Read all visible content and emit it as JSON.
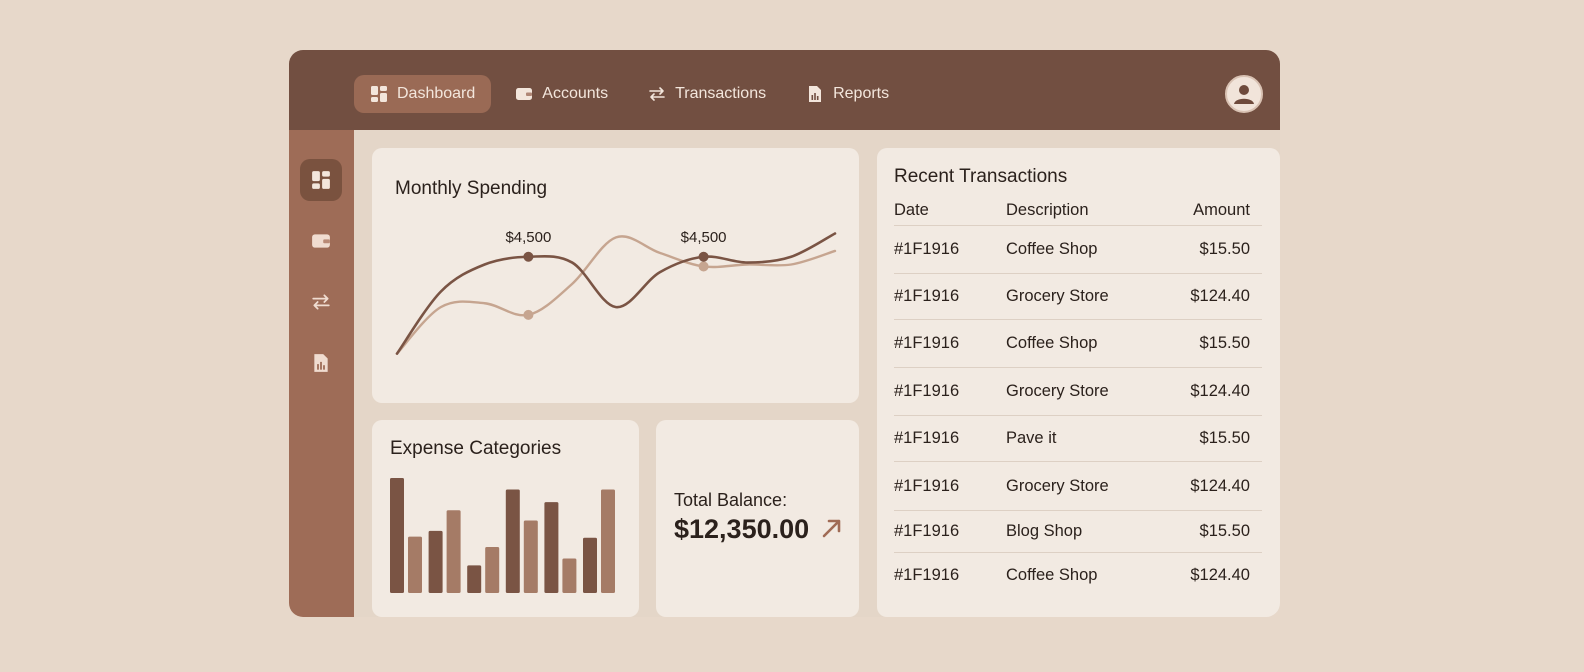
{
  "nav": {
    "items": [
      {
        "label": "Dashboard",
        "icon": "dashboard-icon",
        "active": true
      },
      {
        "label": "Accounts",
        "icon": "wallet-icon",
        "active": false
      },
      {
        "label": "Transactions",
        "icon": "transfer-icon",
        "active": false
      },
      {
        "label": "Reports",
        "icon": "report-icon",
        "active": false
      }
    ]
  },
  "sidebar": {
    "items": [
      {
        "icon": "dashboard-icon",
        "active": true
      },
      {
        "icon": "wallet-icon",
        "active": false
      },
      {
        "icon": "transfer-icon",
        "active": false
      },
      {
        "icon": "report-icon",
        "active": false
      }
    ]
  },
  "monthly_spending": {
    "title": "Monthly Spending",
    "labels": [
      "$4,500",
      "$4,500"
    ]
  },
  "expense_categories": {
    "title": "Expense Categories"
  },
  "balance": {
    "label": "Total Balance:",
    "value": "$12,350.00"
  },
  "transactions": {
    "title": "Recent Transactions",
    "headers": {
      "date": "Date",
      "description": "Description",
      "amount": "Amount"
    },
    "rows": [
      {
        "date": "#1F1916",
        "description": "Coffee Shop",
        "amount": "$15.50"
      },
      {
        "date": "#1F1916",
        "description": "Grocery Store",
        "amount": "$124.40"
      },
      {
        "date": "#1F1916",
        "description": "Coffee Shop",
        "amount": "$15.50"
      },
      {
        "date": "#1F1916",
        "description": "Grocery Store",
        "amount": "$124.40"
      },
      {
        "date": "#1F1916",
        "description": "Pave it",
        "amount": "$15.50"
      },
      {
        "date": "#1F1916",
        "description": "Grocery Store",
        "amount": "$124.40"
      },
      {
        "date": "#1F1916",
        "description": "Blog Shop",
        "amount": "$15.50"
      },
      {
        "date": "#1F1916",
        "description": "Coffee Shop",
        "amount": "$124.40"
      }
    ]
  },
  "colors": {
    "topbar": "#724f41",
    "sidebar": "#9e6c57",
    "active_pill": "#9a6a55",
    "card": "#f2eae2",
    "background": "#e7d8ca",
    "series_dark": "#7a5444",
    "series_light": "#c6a590",
    "accent_arrow": "#a06b55"
  },
  "chart_data": [
    {
      "type": "line",
      "title": "Monthly Spending",
      "x": [
        0,
        1,
        2,
        3,
        4,
        5,
        6,
        7,
        8,
        9,
        10
      ],
      "series": [
        {
          "values": [
            2000,
            3600,
            4300,
            4500,
            4350,
            3200,
            4100,
            4500,
            4350,
            4500,
            5100
          ]
        },
        {
          "values": [
            2000,
            3200,
            3300,
            3000,
            3800,
            5000,
            4600,
            4250,
            4300,
            4300,
            4650
          ]
        }
      ],
      "annotations": [
        {
          "x": 3,
          "series": 0,
          "label": "$4,500"
        },
        {
          "x": 7,
          "series": 0,
          "label": "$4,500"
        }
      ],
      "ylim": [
        1500,
        5500
      ],
      "grid": false
    },
    {
      "type": "bar",
      "title": "Expense Categories",
      "categories": [
        "1",
        "2",
        "3",
        "4",
        "5",
        "6"
      ],
      "series": [
        {
          "values": [
            100,
            54,
            24,
            90,
            79,
            48
          ]
        },
        {
          "values": [
            49,
            72,
            40,
            63,
            30,
            90
          ]
        }
      ],
      "ylim": [
        0,
        100
      ],
      "grid": false
    }
  ]
}
